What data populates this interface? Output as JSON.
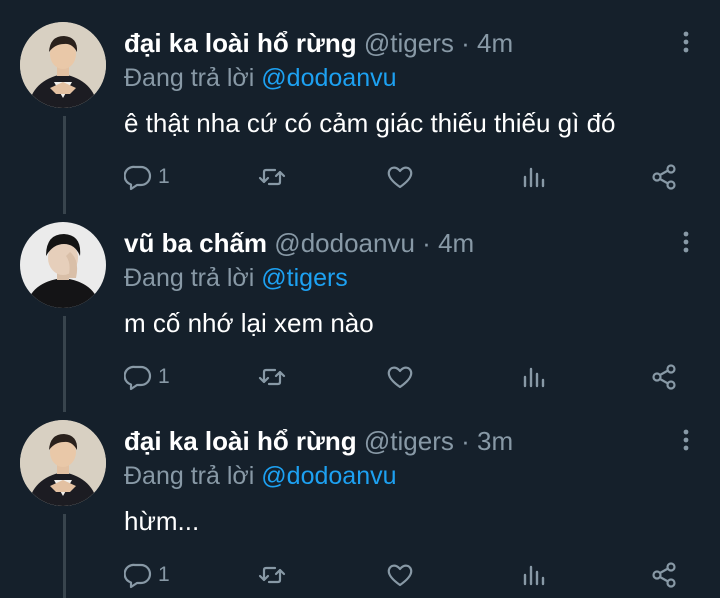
{
  "tweets": [
    {
      "author_name": "đại ka loài hổ rừng",
      "handle": "@tigers",
      "time": "4m",
      "reply_prefix": "Đang trả lời",
      "reply_to": "@dodoanvu",
      "text": "ê thật nha cứ có cảm giác thiếu thiếu gì đó",
      "reply_count": "1"
    },
    {
      "author_name": "vũ ba chấm",
      "handle": "@dodoanvu",
      "time": "4m",
      "reply_prefix": "Đang trả lời",
      "reply_to": "@tigers",
      "text": "m cố nhớ lại xem nào",
      "reply_count": "1"
    },
    {
      "author_name": "đại ka loài hổ rừng",
      "handle": "@tigers",
      "time": "3m",
      "reply_prefix": "Đang trả lời",
      "reply_to": "@dodoanvu",
      "text": "hừm...",
      "reply_count": "1"
    }
  ],
  "separator": "·",
  "colors": {
    "background": "#15202b",
    "secondary_text": "#8899a6",
    "link": "#1da1f2",
    "thread_line": "#38444d"
  }
}
